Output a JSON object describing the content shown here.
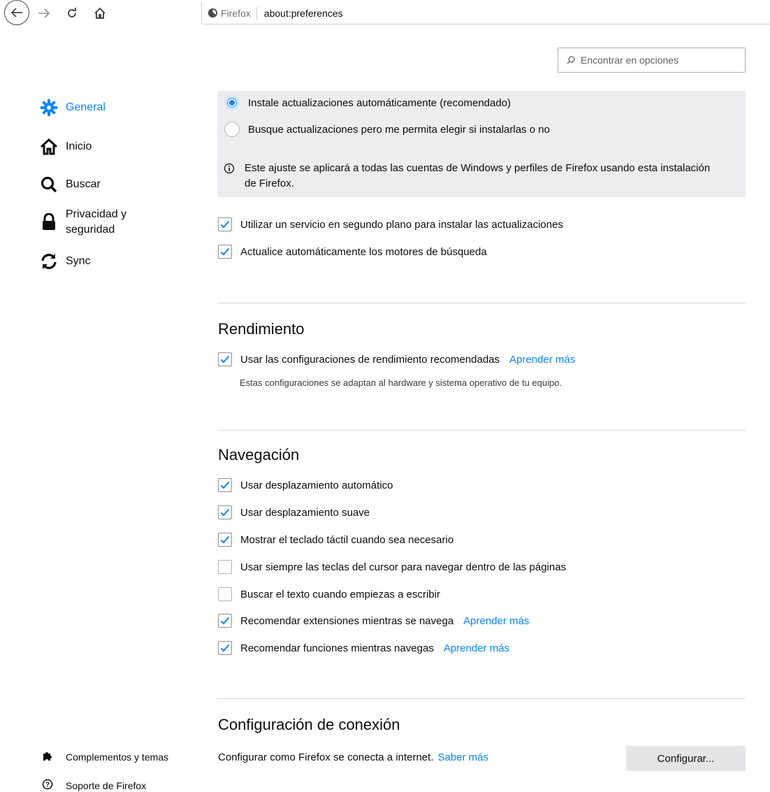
{
  "toolbar": {
    "identity_label": "Firefox",
    "url": "about:preferences"
  },
  "search": {
    "placeholder": "Encontrar en opciones"
  },
  "sidebar": {
    "items": [
      {
        "label": "General",
        "icon": "gear-icon",
        "selected": true
      },
      {
        "label": "Inicio",
        "icon": "home-icon"
      },
      {
        "label": "Buscar",
        "icon": "search-icon"
      },
      {
        "label": "Privacidad y seguridad",
        "icon": "lock-icon"
      },
      {
        "label": "Sync",
        "icon": "sync-icon"
      }
    ],
    "footer": [
      {
        "label": "Complementos y temas",
        "icon": "puzzle-icon"
      },
      {
        "label": "Soporte de Firefox",
        "icon": "help-icon"
      }
    ]
  },
  "updates": {
    "radio_auto": {
      "label": "Instale actualizaciones automáticamente (recomendado)",
      "checked": true
    },
    "radio_check": {
      "label": "Busque actualizaciones pero me permita elegir si instalarlas o no",
      "checked": false
    },
    "info": "Este ajuste se aplicará a todas las cuentas de Windows y perfiles de Firefox usando esta instalación de Firefox.",
    "background_service": {
      "label": "Utilizar un servicio en segundo plano para instalar las actualizaciones",
      "checked": true
    },
    "search_engines": {
      "label": "Actualice automáticamente los motores de búsqueda",
      "checked": true
    }
  },
  "performance": {
    "heading": "Rendimiento",
    "recommended": {
      "label": "Usar las configuraciones de rendimiento recomendadas",
      "checked": true,
      "link": "Aprender más"
    },
    "description": "Estas configuraciones se adaptan al hardware y sistema operativo de tu equipo."
  },
  "browsing": {
    "heading": "Navegación",
    "options": [
      {
        "label": "Usar desplazamiento automático",
        "checked": true
      },
      {
        "label": "Usar desplazamiento suave",
        "checked": true
      },
      {
        "label": "Mostrar el teclado táctil cuando sea necesario",
        "checked": true
      },
      {
        "label": "Usar siempre las teclas del cursor para navegar dentro de las páginas",
        "checked": false
      },
      {
        "label": "Buscar el texto cuando empiezas a escribir",
        "checked": false
      },
      {
        "label": "Recomendar extensiones mientras se navega",
        "checked": true,
        "link": "Aprender más"
      },
      {
        "label": "Recomendar funciones mientras navegas",
        "checked": true,
        "link": "Aprender más"
      }
    ]
  },
  "connection": {
    "heading": "Configuración de conexión",
    "text": "Configurar como Firefox se conecta a internet.",
    "link": "Saber más",
    "button": "Configurar..."
  },
  "colors": {
    "accent": "#0a84ff",
    "box_bg": "#ededf0"
  }
}
